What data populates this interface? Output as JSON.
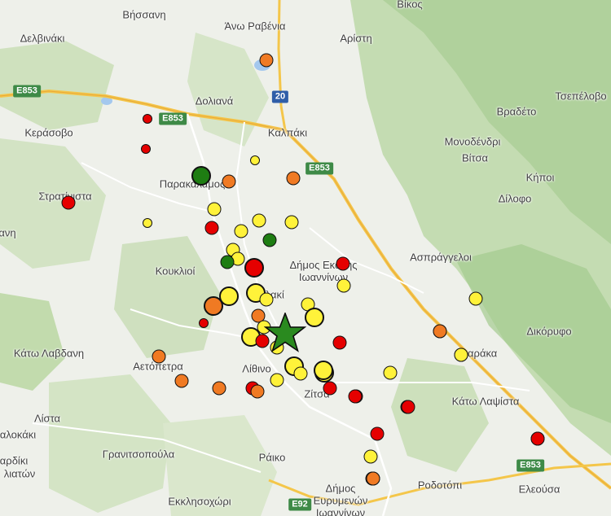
{
  "places": [
    {
      "id": "vikos",
      "label": "Βίκος"
    },
    {
      "id": "vissani",
      "label": "Βήσσανη"
    },
    {
      "id": "delvinaki",
      "label": "Δελβινάκι"
    },
    {
      "id": "ano-ravenia",
      "label": "Άνω Ραβένια"
    },
    {
      "id": "aristi",
      "label": "Αρίστη"
    },
    {
      "id": "doliana",
      "label": "Δολιανά"
    },
    {
      "id": "vradeto",
      "label": "Βραδέτο"
    },
    {
      "id": "tsepelovo",
      "label": "Τσεπέλοβο"
    },
    {
      "id": "kerasovo",
      "label": "Κεράσοβο"
    },
    {
      "id": "kalpaki",
      "label": "Καλπάκι"
    },
    {
      "id": "monodendri",
      "label": "Μονοδένδρι"
    },
    {
      "id": "vitsa",
      "label": "Βίτσα"
    },
    {
      "id": "kipoi",
      "label": "Κήποι"
    },
    {
      "id": "stratiniста",
      "label": "Στρατίνιστα"
    },
    {
      "id": "parakalamos",
      "label": "Παρακάλαμος"
    },
    {
      "id": "dilofo",
      "label": "Δίλοφο"
    },
    {
      "id": "koukliοi",
      "label": "Κουκλιοί"
    },
    {
      "id": "dimos-ekalis",
      "label": "Δήμος Εκάλης\nΙωαννίνων"
    },
    {
      "id": "asprangeloi",
      "label": "Ασπράγγελοι"
    },
    {
      "id": "vlaki",
      "label": "Βλακί"
    },
    {
      "id": "dikorfo",
      "label": "Δικόρυφο"
    },
    {
      "id": "kato-lavdani",
      "label": "Κάτω Λαβδανη"
    },
    {
      "id": "aetopetra",
      "label": "Αετόπετρα"
    },
    {
      "id": "lithino",
      "label": "Λίθινο"
    },
    {
      "id": "farmaka",
      "label": "Φαράκα"
    },
    {
      "id": "zitsa",
      "label": "Ζίτσα"
    },
    {
      "id": "kato-lapsista",
      "label": "Κάτω Λαψίστα"
    },
    {
      "id": "lista",
      "label": "Λίστα"
    },
    {
      "id": "alokaki",
      "label": "αλοκάκι"
    },
    {
      "id": "granitsopoula",
      "label": "Γρανιτσοπούλα"
    },
    {
      "id": "raiko",
      "label": "Ράικο"
    },
    {
      "id": "ardiki",
      "label": "αρδίκι"
    },
    {
      "id": "liaton",
      "label": "λιατών"
    },
    {
      "id": "rodotopi",
      "label": "Ροδοτόπι"
    },
    {
      "id": "dimos-evrymenon",
      "label": "Δήμος\nΕυρυμενών\nΙωαννίνων"
    },
    {
      "id": "ekklisochori",
      "label": "Εκκλησοχώρι"
    },
    {
      "id": "eleousa",
      "label": "Ελεούσα"
    },
    {
      "id": "ani",
      "label": "ανη"
    }
  ],
  "road_shields": [
    {
      "id": "e853-west",
      "label": "E853",
      "color": "green"
    },
    {
      "id": "e853-mid",
      "label": "E853",
      "color": "green"
    },
    {
      "id": "e853-kalpaki",
      "label": "E853",
      "color": "green"
    },
    {
      "id": "r20",
      "label": "20",
      "color": "blue"
    },
    {
      "id": "e853-east",
      "label": "E853",
      "color": "green"
    },
    {
      "id": "e92",
      "label": "E92",
      "color": "green"
    }
  ],
  "earthquakes": [
    {
      "id": "q1",
      "level": "orange",
      "size": "m"
    },
    {
      "id": "q2",
      "level": "red",
      "size": "s"
    },
    {
      "id": "q3",
      "level": "red",
      "size": "s"
    },
    {
      "id": "q4",
      "level": "green",
      "size": "l"
    },
    {
      "id": "q5",
      "level": "orange",
      "size": "m"
    },
    {
      "id": "q6",
      "level": "yellow",
      "size": "s"
    },
    {
      "id": "q7",
      "level": "orange",
      "size": "m"
    },
    {
      "id": "q8",
      "level": "red",
      "size": "m"
    },
    {
      "id": "q9",
      "level": "yellow",
      "size": "m"
    },
    {
      "id": "q10",
      "level": "yellow",
      "size": "s"
    },
    {
      "id": "q11",
      "level": "red",
      "size": "m"
    },
    {
      "id": "q12",
      "level": "yellow",
      "size": "m"
    },
    {
      "id": "q13",
      "level": "yellow",
      "size": "m"
    },
    {
      "id": "q14",
      "level": "yellow",
      "size": "m"
    },
    {
      "id": "q15",
      "level": "green",
      "size": "m"
    },
    {
      "id": "q16",
      "level": "yellow",
      "size": "m"
    },
    {
      "id": "q17",
      "level": "yellow",
      "size": "m"
    },
    {
      "id": "q18",
      "level": "green",
      "size": "m"
    },
    {
      "id": "q19",
      "level": "red",
      "size": "l"
    },
    {
      "id": "q20",
      "level": "red",
      "size": "m"
    },
    {
      "id": "q21",
      "level": "yellow",
      "size": "m"
    },
    {
      "id": "q22",
      "level": "yellow",
      "size": "l"
    },
    {
      "id": "q23",
      "level": "orange",
      "size": "l"
    },
    {
      "id": "q24",
      "level": "yellow",
      "size": "l"
    },
    {
      "id": "q25",
      "level": "yellow",
      "size": "m"
    },
    {
      "id": "q26",
      "level": "yellow",
      "size": "m"
    },
    {
      "id": "q27",
      "level": "yellow",
      "size": "l"
    },
    {
      "id": "q28",
      "level": "orange",
      "size": "m"
    },
    {
      "id": "q29",
      "level": "red",
      "size": "s"
    },
    {
      "id": "q30",
      "level": "yellow",
      "size": "m"
    },
    {
      "id": "q31",
      "level": "yellow",
      "size": "l"
    },
    {
      "id": "q32",
      "level": "red",
      "size": "m"
    },
    {
      "id": "q33",
      "level": "yellow",
      "size": "m"
    },
    {
      "id": "q34",
      "level": "red",
      "size": "m"
    },
    {
      "id": "q35",
      "level": "yellow",
      "size": "l"
    },
    {
      "id": "q36",
      "level": "yellow",
      "size": "l"
    },
    {
      "id": "q37",
      "level": "yellow",
      "size": "m"
    },
    {
      "id": "q38",
      "level": "yellow",
      "size": "l"
    },
    {
      "id": "q39",
      "level": "red",
      "size": "m"
    },
    {
      "id": "q40",
      "level": "red",
      "size": "m"
    },
    {
      "id": "q41",
      "level": "orange",
      "size": "m"
    },
    {
      "id": "q42",
      "level": "yellow",
      "size": "m"
    },
    {
      "id": "q43",
      "level": "orange",
      "size": "m"
    },
    {
      "id": "q44",
      "level": "orange",
      "size": "m"
    },
    {
      "id": "q45",
      "level": "orange",
      "size": "m"
    },
    {
      "id": "q46",
      "level": "orange",
      "size": "m"
    },
    {
      "id": "q47",
      "level": "red",
      "size": "m"
    },
    {
      "id": "q48",
      "level": "orange",
      "size": "m"
    },
    {
      "id": "q49",
      "level": "red",
      "size": "m"
    },
    {
      "id": "q50",
      "level": "red",
      "size": "m"
    },
    {
      "id": "q51",
      "level": "red",
      "size": "m"
    },
    {
      "id": "q52",
      "level": "yellow",
      "size": "m"
    },
    {
      "id": "q53",
      "level": "orange",
      "size": "m"
    },
    {
      "id": "q54",
      "level": "red",
      "size": "m"
    },
    {
      "id": "q55",
      "level": "yellow",
      "size": "m"
    },
    {
      "id": "q56",
      "level": "yellow",
      "size": "m"
    },
    {
      "id": "q57",
      "level": "orange",
      "size": "m"
    },
    {
      "id": "q58",
      "level": "yellow",
      "size": "m"
    },
    {
      "id": "q59",
      "level": "red",
      "size": "m"
    },
    {
      "id": "q60",
      "level": "red",
      "size": "m"
    },
    {
      "id": "q61",
      "level": "yellow",
      "size": "m"
    },
    {
      "id": "q62",
      "level": "orange",
      "size": "m"
    }
  ],
  "epicenter": {
    "icon": "star-icon",
    "color": "#2a8a1f"
  },
  "colors": {
    "red": "#e50000",
    "orange": "#f07a23",
    "yellow": "#fff23a",
    "green": "#1e7d12",
    "land": "#eef0ea",
    "forest": "#c9dfb9",
    "mountain": "#a9cd94",
    "water": "#a4c8ee"
  }
}
